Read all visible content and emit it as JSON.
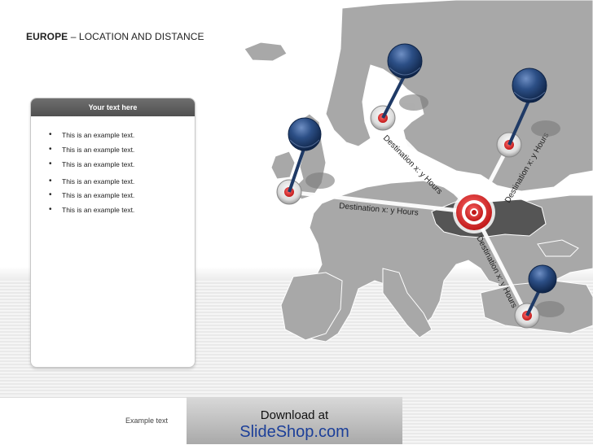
{
  "title": {
    "bold": "EUROPE",
    "rest": " – LOCATION AND DISTANCE"
  },
  "panel": {
    "heading": "Your text here",
    "items": [
      "This is an example text.",
      "This is an example text.",
      "This is an example text.",
      "This is an example text.",
      "This is an example text.",
      "This is an example text."
    ]
  },
  "routes": {
    "scandinavia": "Destination x: y Hours",
    "uk": "Destination x: y Hours",
    "russia": "Destination x: y Hours",
    "turkey": "Destination x: y Hours"
  },
  "footer": {
    "example_text": "Example text",
    "download_line1": "Download at",
    "download_line2": "SlideShop.com"
  },
  "colors": {
    "land": "#a8a8a8",
    "highlight_country": "#555555",
    "pin_blue": "#1f3a66",
    "target_red": "#d82b2b"
  }
}
